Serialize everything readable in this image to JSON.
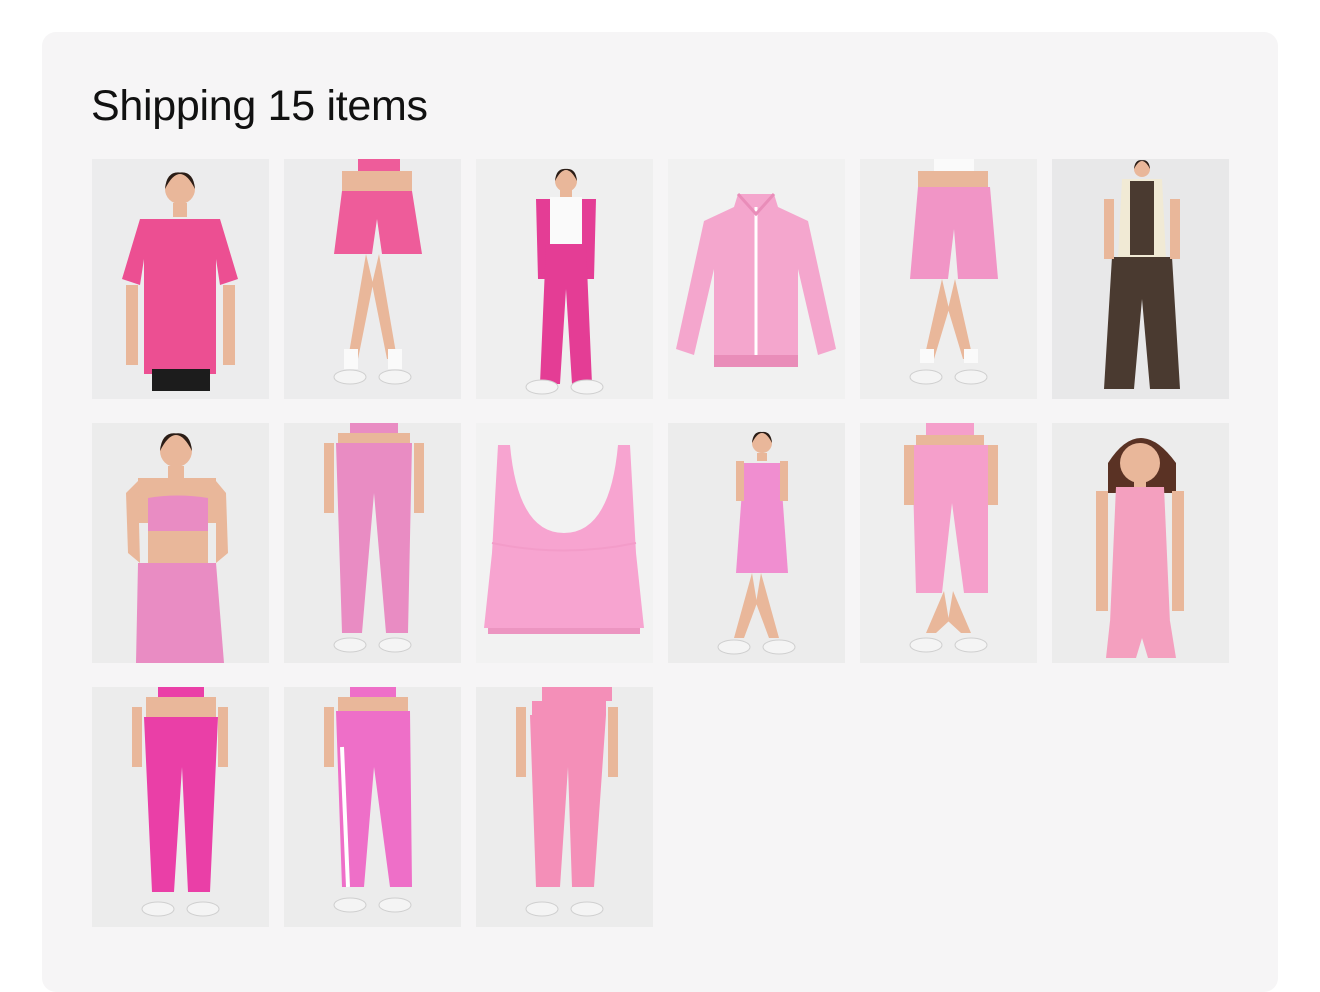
{
  "shipping": {
    "title": "Shipping 15 items"
  },
  "items": [
    {
      "id": 1,
      "kind": "model-tshirt",
      "bg": "#ececed",
      "color": "#ec4f92"
    },
    {
      "id": 2,
      "kind": "model-shorts",
      "bg": "#ececed",
      "color": "#ee5c9a"
    },
    {
      "id": 3,
      "kind": "model-sweatpants",
      "bg": "#efefef",
      "color": "#e43d95"
    },
    {
      "id": 4,
      "kind": "product-jacket",
      "bg": "#f1f1f1",
      "color": "#f4a6cd"
    },
    {
      "id": 5,
      "kind": "model-bike-shorts",
      "bg": "#eeeeee",
      "color": "#f195c6"
    },
    {
      "id": 6,
      "kind": "model-brown-set",
      "bg": "#e8e8e9",
      "color": "#4a3a30"
    },
    {
      "id": 7,
      "kind": "model-printed-set",
      "bg": "#ececec",
      "color": "#e98cc3"
    },
    {
      "id": 8,
      "kind": "model-printed-legging",
      "bg": "#ececec",
      "color": "#e98cc3"
    },
    {
      "id": 9,
      "kind": "product-tank",
      "bg": "#f2f2f2",
      "color": "#f7a4d0"
    },
    {
      "id": 10,
      "kind": "model-dress",
      "bg": "#ececec",
      "color": "#f08ed0"
    },
    {
      "id": 11,
      "kind": "model-capri",
      "bg": "#eeeeee",
      "color": "#f59fcb"
    },
    {
      "id": 12,
      "kind": "model-tank-shorts",
      "bg": "#ececec",
      "color": "#f4a0bf"
    },
    {
      "id": 13,
      "kind": "model-legging",
      "bg": "#ececec",
      "color": "#ea3fa7"
    },
    {
      "id": 14,
      "kind": "model-stripe-legging",
      "bg": "#ececec",
      "color": "#ee6fc8"
    },
    {
      "id": 15,
      "kind": "model-legging-light",
      "bg": "#ececec",
      "color": "#f48fb8"
    }
  ]
}
